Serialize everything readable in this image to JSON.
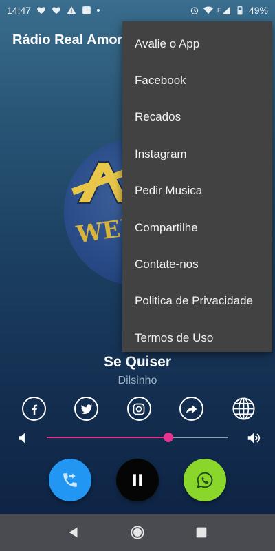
{
  "status_bar": {
    "time": "14:47",
    "network_label": "E",
    "battery_percent": "49%",
    "icons": [
      "heart-monitor-icon",
      "heart-monitor-icon",
      "warning-icon",
      "app-icon",
      "dot-icon",
      "alarm-icon",
      "wifi-icon",
      "signal-icon",
      "battery-icon"
    ]
  },
  "app": {
    "title": "Rádio Real Amor"
  },
  "album_art": {
    "logo_text": "WEB"
  },
  "menu": {
    "items": [
      {
        "label": "Avalie o App"
      },
      {
        "label": "Facebook"
      },
      {
        "label": "Recados"
      },
      {
        "label": "Instagram"
      },
      {
        "label": "Pedir Musica"
      },
      {
        "label": "Compartilhe"
      },
      {
        "label": "Contate-nos"
      },
      {
        "label": "Politica de Privacidade"
      },
      {
        "label": "Termos de Uso"
      }
    ]
  },
  "now_playing": {
    "title": "Se Quiser",
    "artist": "Dilsinho"
  },
  "social": [
    "facebook-icon",
    "twitter-icon",
    "instagram-icon",
    "share-icon",
    "globe-icon"
  ],
  "volume": {
    "level": 0.67,
    "accent_color": "#e6338f"
  },
  "controls": {
    "call_color": "#2196f3",
    "pause_color": "#050505",
    "whatsapp_color": "#8bd62a"
  },
  "nav_bar": {
    "buttons": [
      "back-icon",
      "home-icon",
      "recents-icon"
    ]
  }
}
